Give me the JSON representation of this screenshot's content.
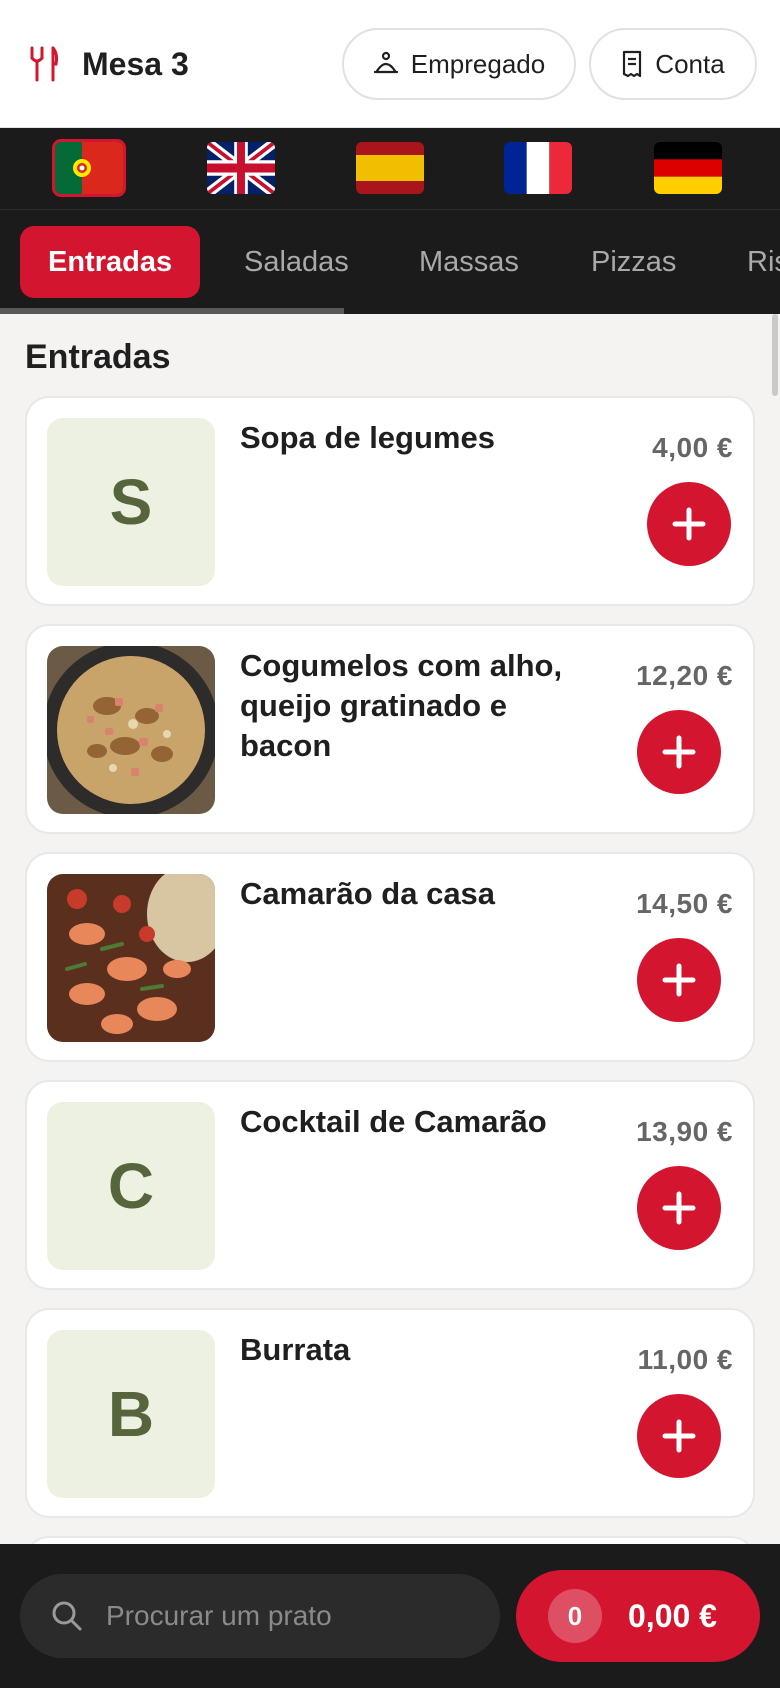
{
  "header": {
    "title": "Mesa 3",
    "waiter_label": "Empregado",
    "bill_label": "Conta",
    "accent": "#d3152f"
  },
  "languages": [
    {
      "code": "pt",
      "active": true
    },
    {
      "code": "en",
      "active": false
    },
    {
      "code": "es",
      "active": false
    },
    {
      "code": "fr",
      "active": false
    },
    {
      "code": "de",
      "active": false
    }
  ],
  "tabs": [
    {
      "label": "Entradas",
      "active": true
    },
    {
      "label": "Saladas",
      "active": false
    },
    {
      "label": "Massas",
      "active": false
    },
    {
      "label": "Pizzas",
      "active": false
    },
    {
      "label": "Ris",
      "active": false
    }
  ],
  "section": {
    "title": "Entradas"
  },
  "dishes": [
    {
      "name": "Sopa de legumes",
      "price": "4,00 €",
      "initial": "S",
      "image": "placeholder-initial"
    },
    {
      "name": "Cogumelos com alho, queijo gratinado e bacon",
      "price": "12,20 €",
      "initial": "",
      "image": "mushroom-photo"
    },
    {
      "name": "Camarão da casa",
      "price": "14,50 €",
      "initial": "",
      "image": "shrimp-photo"
    },
    {
      "name": "Cocktail de Camarão",
      "price": "13,90 €",
      "initial": "C",
      "image": "placeholder-initial"
    },
    {
      "name": "Burrata",
      "price": "11,00 €",
      "initial": "B",
      "image": "placeholder-initial"
    }
  ],
  "footer": {
    "search_placeholder": "Procurar um prato",
    "cart_count": "0",
    "cart_total": "0,00 €"
  }
}
